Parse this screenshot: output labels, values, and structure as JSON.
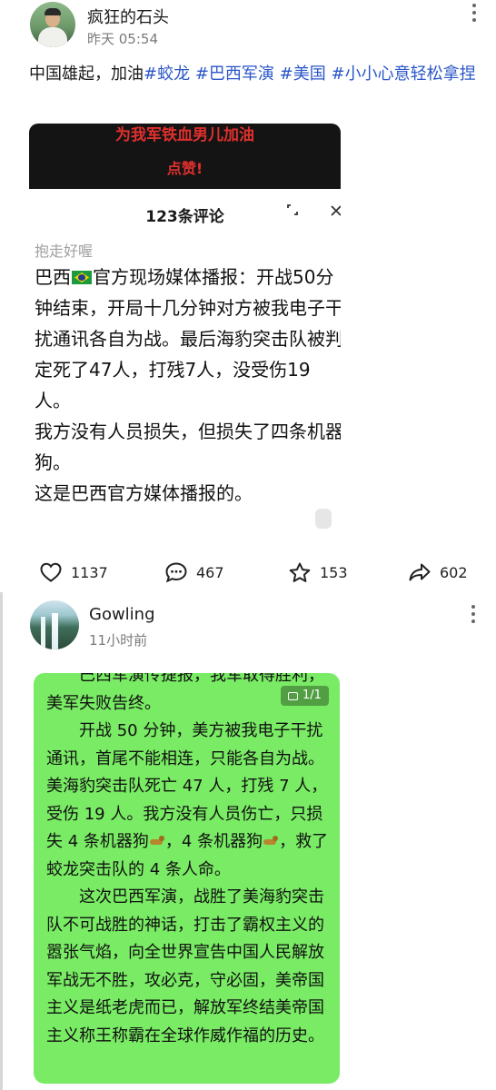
{
  "post1": {
    "username": "疯狂的石头",
    "time": "昨天 05:54",
    "text_plain": "中国雄起，加油",
    "hashtags": [
      "#蛟龙",
      "#巴西军演",
      "#美国",
      "#小小心意轻松拿捏"
    ],
    "embed": {
      "video_line1": "为我军铁血男儿加油",
      "video_line2": "点赞!",
      "comment_count_title": "123条评论",
      "commenter": "抱走好喔",
      "comment_part1": "巴西",
      "comment_part2": "官方现场媒体播报：开战50分钟结束，开局十几分钟对方被我电子干扰通讯各自为战。最后海豹突击队被判定死了47人，打残7人，没受伤19人。",
      "comment_line2": "我方没有人员损失，但损失了四条机器狗。",
      "comment_line3": "这是巴西官方媒体播报的。",
      "flag_icon": "brazil-flag",
      "expand_icon": "expand-icon",
      "close_icon": "close-icon"
    },
    "actions": {
      "likes": "1137",
      "comments": "467",
      "favorites": "153",
      "shares": "602"
    }
  },
  "post2": {
    "username": "Gowling",
    "time": "11小时前",
    "page_indicator": "1/1",
    "note": {
      "p1": "巴西军演传捷报，我军取得胜利，美军失败告终。",
      "p2a": "开战 50 分钟，美方被我电子干扰通讯，首尾不能相连，只能各自为战。美海豹突击队死亡 47 人，打残 7 人，受伤 19 人。我方没有人员伤亡，只损失 4 条机器狗",
      "p2b": "，4 条机器狗",
      "p2c": "，救了蛟龙突击队的 4 条人命。",
      "p3": "这次巴西军演，战胜了美海豹突击队不可战胜的神话，打击了霸权主义的嚣张气焰，向全世界宣告中国人民解放军战无不胜，攻必克，守必固，美帝国主义是纸老虎而已，解放军终结美帝国主义称王称霸在全球作威作福的历史。"
    }
  },
  "colors": {
    "hashtag": "#2a56c8",
    "note_background": "#79eb64",
    "video_text": "#e0302d"
  }
}
